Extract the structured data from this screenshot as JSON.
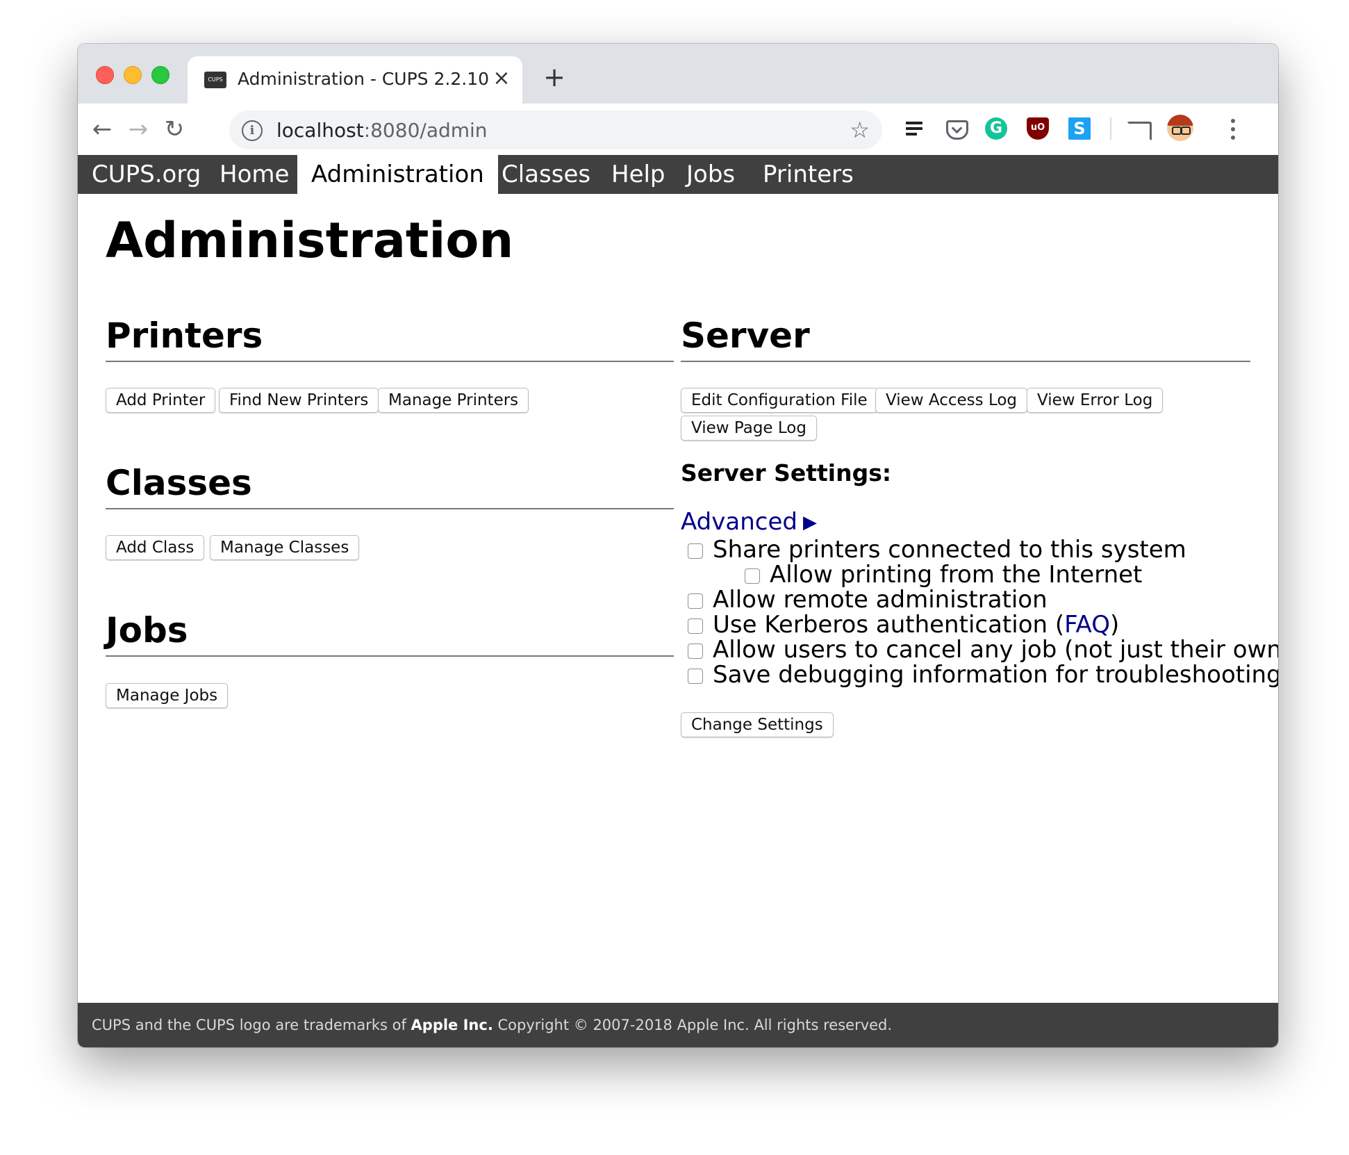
{
  "browser": {
    "tab_favicon_text": "CUPS",
    "tab_title": "Administration - CUPS 2.2.10",
    "tab_close": "×",
    "new_tab": "+",
    "url_host": "localhost",
    "url_rest": ":8080/admin",
    "info_icon": "i",
    "star": "☆",
    "back": "←",
    "forward": "→",
    "reload": "↻",
    "extensions": {
      "grammarly": "G",
      "ublock": "uO",
      "s_ext": "S"
    }
  },
  "nav": {
    "items": [
      "CUPS.org",
      "Home",
      "Administration",
      "Classes",
      "Help",
      "Jobs",
      "Printers"
    ],
    "active": "Administration"
  },
  "page_title": "Administration",
  "printers": {
    "heading": "Printers",
    "buttons": [
      "Add Printer",
      "Find New Printers",
      "Manage Printers"
    ]
  },
  "classes": {
    "heading": "Classes",
    "buttons": [
      "Add Class",
      "Manage Classes"
    ]
  },
  "jobs": {
    "heading": "Jobs",
    "buttons": [
      "Manage Jobs"
    ]
  },
  "server": {
    "heading": "Server",
    "buttons": [
      "Edit Configuration File",
      "View Access Log",
      "View Error Log",
      "View Page Log"
    ],
    "settings_heading": "Server Settings:",
    "advanced_link": "Advanced",
    "advanced_arrow": "▶",
    "options": [
      {
        "label": "Share printers connected to this system",
        "checked": false
      },
      {
        "label": "Allow printing from the Internet",
        "checked": false
      },
      {
        "label": "Allow remote administration",
        "checked": false
      },
      {
        "label_prefix": "Use Kerberos authentication (",
        "link": "FAQ",
        "label_suffix": ")",
        "checked": false
      },
      {
        "label": "Allow users to cancel any job (not just their own)",
        "checked": false
      },
      {
        "label": "Save debugging information for troubleshooting",
        "checked": false
      }
    ],
    "change_button": "Change Settings"
  },
  "footer": {
    "prefix": "CUPS and the CUPS logo are trademarks of ",
    "apple": "Apple Inc.",
    "suffix": " Copyright © 2007-2018 Apple Inc. All rights reserved."
  }
}
